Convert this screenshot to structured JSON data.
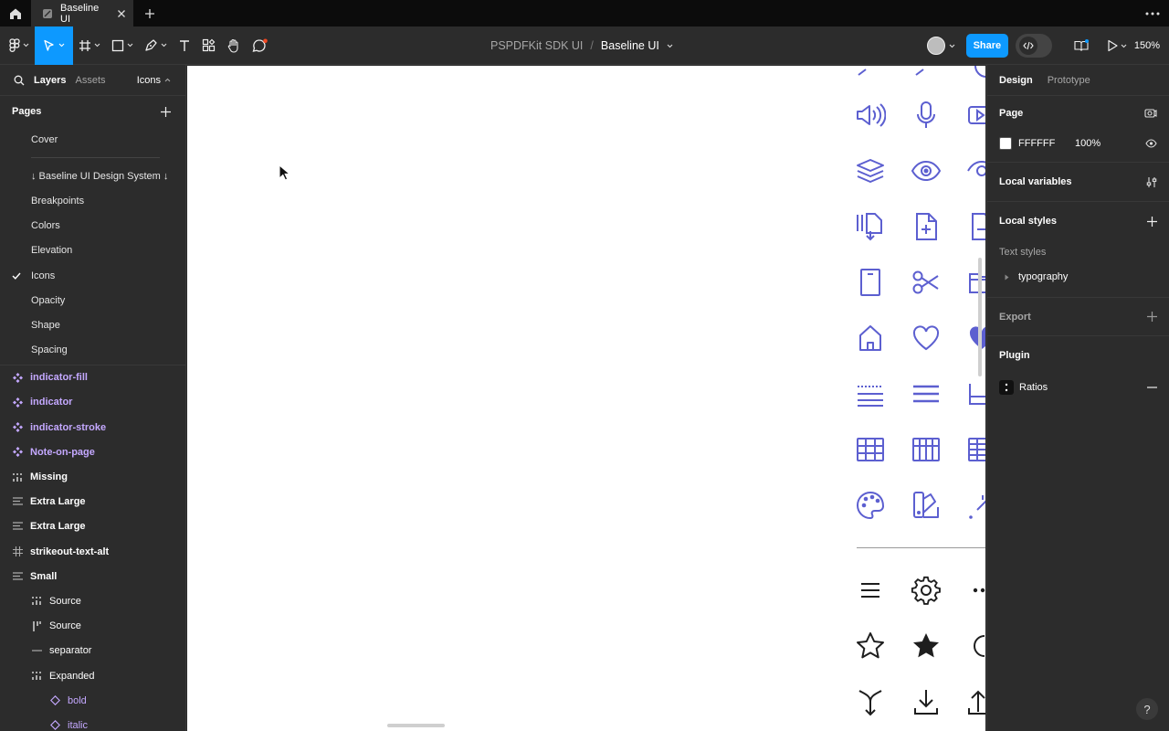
{
  "tabbar": {
    "tab_title": "Baseline UI"
  },
  "toolbar": {
    "project": "PSPDFKit SDK UI",
    "separator": "/",
    "file": "Baseline UI",
    "share_label": "Share",
    "zoom": "150%",
    "accent": "#0d99ff"
  },
  "left_panel": {
    "tabs": [
      "Layers",
      "Assets"
    ],
    "current_page": "Icons",
    "pages_heading": "Pages",
    "pages": [
      {
        "label": "Cover",
        "checked": false
      },
      {
        "label": "↓ Baseline UI Design System ↓",
        "checked": false
      },
      {
        "label": "Breakpoints",
        "checked": false
      },
      {
        "label": "Colors",
        "checked": false
      },
      {
        "label": "Elevation",
        "checked": false
      },
      {
        "label": "Icons",
        "checked": true
      },
      {
        "label": "Opacity",
        "checked": false
      },
      {
        "label": "Shape",
        "checked": false
      },
      {
        "label": "Spacing",
        "checked": false
      }
    ],
    "layers": [
      {
        "label": "indicator-fill",
        "icon": "component-icon",
        "level": 0
      },
      {
        "label": "indicator",
        "icon": "component-icon",
        "level": 0
      },
      {
        "label": "indicator-stroke",
        "icon": "component-icon",
        "level": 0
      },
      {
        "label": "Note-on-page",
        "icon": "component-icon",
        "level": 0
      },
      {
        "label": "Missing",
        "icon": "autolayout-grid-icon",
        "level": 0
      },
      {
        "label": "Extra Large",
        "icon": "text-lines-icon",
        "level": 0
      },
      {
        "label": "Extra Large",
        "icon": "text-lines-icon",
        "level": 0
      },
      {
        "label": "strikeout-text-alt",
        "icon": "frame-icon",
        "level": 0
      },
      {
        "label": "Small",
        "icon": "text-lines-icon",
        "level": 0
      },
      {
        "label": "Source",
        "icon": "autolayout-grid-icon",
        "level": 1
      },
      {
        "label": "Source",
        "icon": "autolayout-vertical-icon",
        "level": 1
      },
      {
        "label": "separator",
        "icon": "line-icon",
        "level": 1
      },
      {
        "label": "Expanded",
        "icon": "autolayout-grid-icon",
        "level": 1
      },
      {
        "label": "bold",
        "icon": "instance-icon",
        "level": 2
      },
      {
        "label": "italic",
        "icon": "instance-icon",
        "level": 2
      }
    ]
  },
  "right_panel": {
    "tabs": [
      "Design",
      "Prototype"
    ],
    "page_heading": "Page",
    "page_color": "FFFFFF",
    "page_opacity": "100%",
    "local_variables": "Local variables",
    "local_styles": "Local styles",
    "text_styles": "Text styles",
    "typography": "typography",
    "export": "Export",
    "plugin": "Plugin",
    "plugin_name": "Ratios",
    "help": "?"
  },
  "canvas": {
    "icon_color": "#5c5fd0",
    "dark_icon_color": "#1e1e1e"
  }
}
